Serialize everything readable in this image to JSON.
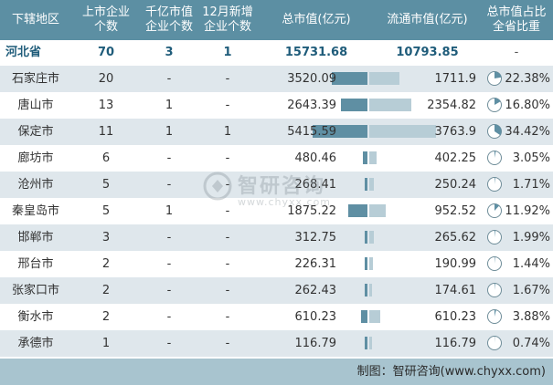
{
  "chart_data": {
    "type": "table",
    "columns": [
      "下辖地区",
      "上市企业\n个数",
      "千亿市值\n企业个数",
      "12月新增\n企业个数",
      "总市值(亿元)",
      "流通市值(亿元)",
      "总市值占比\n全省比重"
    ],
    "province": {
      "region": "河北省",
      "listed": "70",
      "over_100b": "3",
      "new_dec": "1",
      "total_cap": "15731.68",
      "circ_cap": "10793.85",
      "share": "-"
    },
    "rows": [
      {
        "region": "石家庄市",
        "listed": "20",
        "over_100b": "-",
        "new_dec": "-",
        "total_cap": 3520.09,
        "circ_cap": 1711.9,
        "share": "22.38%",
        "share_value": 22.38
      },
      {
        "region": "唐山市",
        "listed": "13",
        "over_100b": "1",
        "new_dec": "-",
        "total_cap": 2643.39,
        "circ_cap": 2354.82,
        "share": "16.80%",
        "share_value": 16.8
      },
      {
        "region": "保定市",
        "listed": "11",
        "over_100b": "1",
        "new_dec": "1",
        "total_cap": 5415.59,
        "circ_cap": 3763.9,
        "share": "34.42%",
        "share_value": 34.42
      },
      {
        "region": "廊坊市",
        "listed": "6",
        "over_100b": "-",
        "new_dec": "-",
        "total_cap": 480.46,
        "circ_cap": 402.25,
        "share": "3.05%",
        "share_value": 3.05
      },
      {
        "region": "沧州市",
        "listed": "5",
        "over_100b": "-",
        "new_dec": "-",
        "total_cap": 268.41,
        "circ_cap": 250.24,
        "share": "1.71%",
        "share_value": 1.71
      },
      {
        "region": "秦皇岛市",
        "listed": "5",
        "over_100b": "1",
        "new_dec": "-",
        "total_cap": 1875.22,
        "circ_cap": 952.52,
        "share": "11.92%",
        "share_value": 11.92
      },
      {
        "region": "邯郸市",
        "listed": "3",
        "over_100b": "-",
        "new_dec": "-",
        "total_cap": 312.75,
        "circ_cap": 265.62,
        "share": "1.99%",
        "share_value": 1.99
      },
      {
        "region": "邢台市",
        "listed": "2",
        "over_100b": "-",
        "new_dec": "-",
        "total_cap": 226.31,
        "circ_cap": 190.99,
        "share": "1.44%",
        "share_value": 1.44
      },
      {
        "region": "张家口市",
        "listed": "2",
        "over_100b": "-",
        "new_dec": "-",
        "total_cap": 262.43,
        "circ_cap": 174.61,
        "share": "1.67%",
        "share_value": 1.67
      },
      {
        "region": "衡水市",
        "listed": "2",
        "over_100b": "-",
        "new_dec": "-",
        "total_cap": 610.23,
        "circ_cap": 610.23,
        "share": "3.88%",
        "share_value": 3.88
      },
      {
        "region": "承德市",
        "listed": "1",
        "over_100b": "-",
        "new_dec": "-",
        "total_cap": 116.79,
        "circ_cap": 116.79,
        "share": "0.74%",
        "share_value": 0.74
      }
    ],
    "total_cap_max": 5415.59,
    "circ_cap_max": 3763.9
  },
  "footer": {
    "source": "制图：智研咨询(www.chyxx.com)"
  },
  "watermark": {
    "name": "智研咨询",
    "url": "www.chyxx.com"
  },
  "colors": {
    "header_bg": "#5c8fa3",
    "total_bar": "#5f8fa3",
    "circ_bar": "#b7cdd6",
    "row_alt": "#dfe7ec",
    "pie_fill": "#5f8fa3",
    "province_text": "#1f5c7a"
  }
}
